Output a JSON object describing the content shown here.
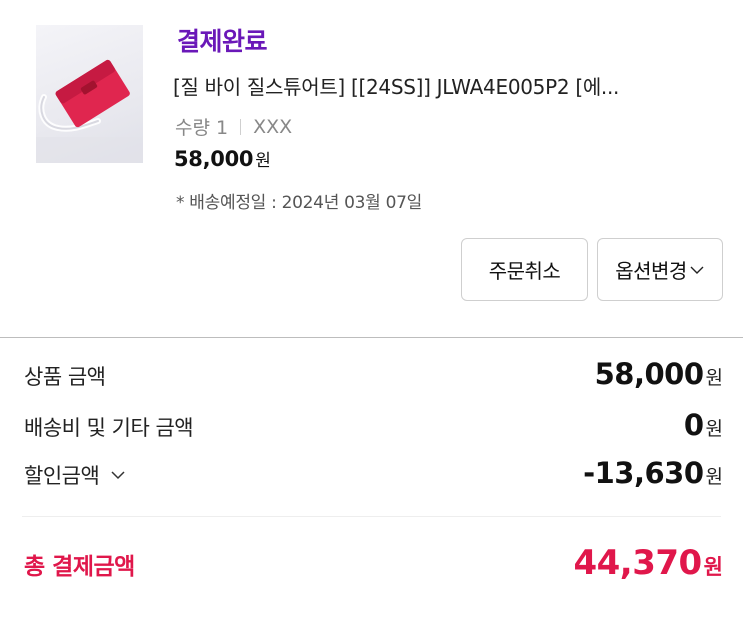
{
  "order_item": {
    "status": "결제완료",
    "product_name": "[질 바이 질스튜어트] [[24SS]] JLWA4E005P2 [에...",
    "quantity_label": "수량 1",
    "option_value": "XXX",
    "price": "58,000",
    "price_unit": "원",
    "shipping_estimate": "* 배송예정일 : 2024년 03월 07일",
    "thumbnail_icon": "product-thumbnail-red-wallet-icon"
  },
  "actions": {
    "cancel_label": "주문취소",
    "option_change_label": "옵션변경"
  },
  "summary": {
    "rows": [
      {
        "label": "상품 금액",
        "value": "58,000",
        "unit": "원"
      },
      {
        "label": "배송비 및 기타 금액",
        "value": "0",
        "unit": "원"
      },
      {
        "label": "할인금액",
        "value": "-13,630",
        "unit": "원"
      }
    ],
    "total": {
      "label": "총 결제금액",
      "value": "44,370",
      "unit": "원"
    }
  },
  "colors": {
    "status": "#6a18b8",
    "total_accent": "#e0174b",
    "product_red": "#e0264f"
  }
}
